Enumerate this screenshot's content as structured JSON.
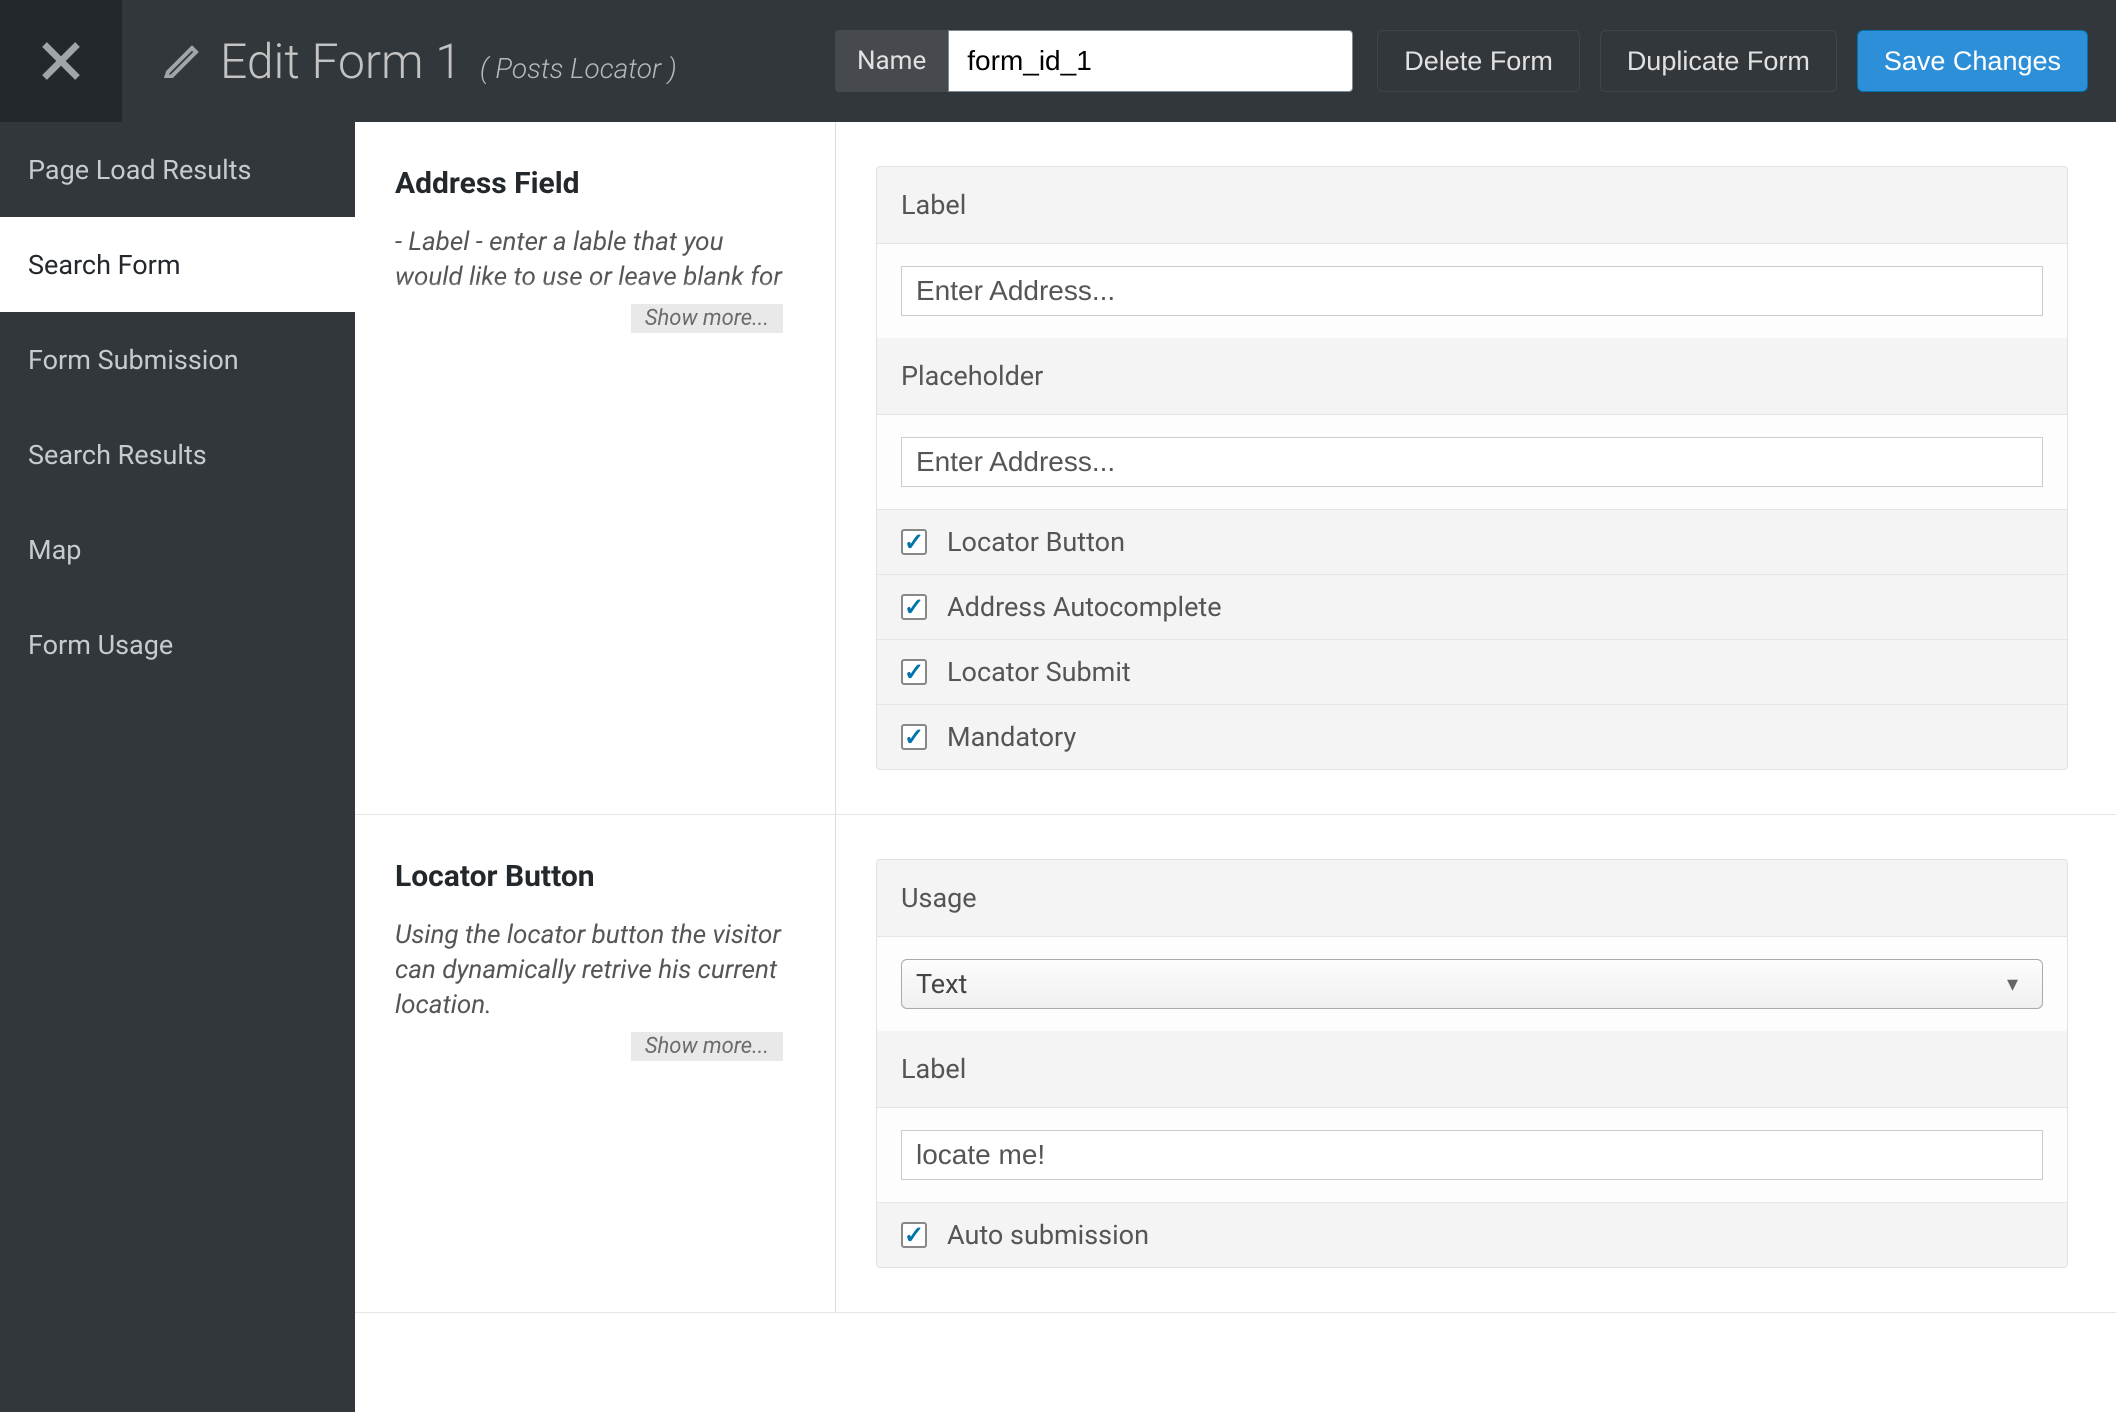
{
  "header": {
    "title": "Edit Form 1",
    "subtitle": "( Posts Locator )",
    "name_label": "Name",
    "name_value": "form_id_1",
    "delete_label": "Delete Form",
    "duplicate_label": "Duplicate Form",
    "save_label": "Save Changes"
  },
  "sidebar": {
    "items": [
      {
        "label": "Page Load Results"
      },
      {
        "label": "Search Form"
      },
      {
        "label": "Form Submission"
      },
      {
        "label": "Search Results"
      },
      {
        "label": "Map"
      },
      {
        "label": "Form Usage"
      }
    ],
    "active_index": 1
  },
  "sections": {
    "address_field": {
      "title": "Address Field",
      "desc": "- Label - enter a lable that you would like to use or leave blank for",
      "show_more": "Show more...",
      "label_head": "Label",
      "label_value": "Enter Address...",
      "placeholder_head": "Placeholder",
      "placeholder_value": "Enter Address...",
      "checks": [
        {
          "label": "Locator Button",
          "checked": true
        },
        {
          "label": "Address Autocomplete",
          "checked": true
        },
        {
          "label": "Locator Submit",
          "checked": true
        },
        {
          "label": "Mandatory",
          "checked": true
        }
      ]
    },
    "locator_button": {
      "title": "Locator Button",
      "desc": "Using the locator button the visitor can dynamically retrive his current location.",
      "show_more": "Show more...",
      "usage_head": "Usage",
      "usage_value": "Text",
      "label_head": "Label",
      "label_value": "locate me!",
      "auto_submit": {
        "label": "Auto submission",
        "checked": true
      }
    }
  }
}
